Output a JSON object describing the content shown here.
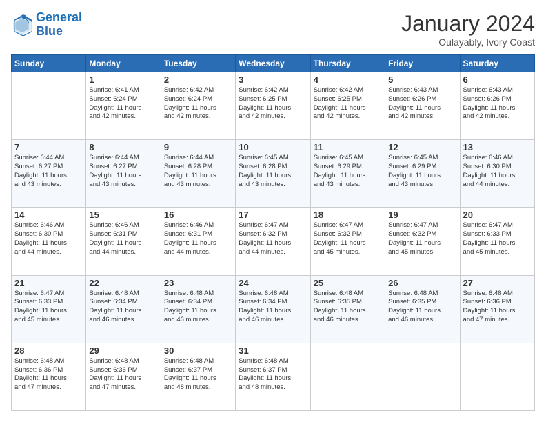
{
  "header": {
    "logo_text_general": "General",
    "logo_text_blue": "Blue",
    "month_title": "January 2024",
    "subtitle": "Oulayably, Ivory Coast"
  },
  "days_of_week": [
    "Sunday",
    "Monday",
    "Tuesday",
    "Wednesday",
    "Thursday",
    "Friday",
    "Saturday"
  ],
  "weeks": [
    [
      {
        "day": "",
        "info": ""
      },
      {
        "day": "1",
        "info": "Sunrise: 6:41 AM\nSunset: 6:24 PM\nDaylight: 11 hours\nand 42 minutes."
      },
      {
        "day": "2",
        "info": "Sunrise: 6:42 AM\nSunset: 6:24 PM\nDaylight: 11 hours\nand 42 minutes."
      },
      {
        "day": "3",
        "info": "Sunrise: 6:42 AM\nSunset: 6:25 PM\nDaylight: 11 hours\nand 42 minutes."
      },
      {
        "day": "4",
        "info": "Sunrise: 6:42 AM\nSunset: 6:25 PM\nDaylight: 11 hours\nand 42 minutes."
      },
      {
        "day": "5",
        "info": "Sunrise: 6:43 AM\nSunset: 6:26 PM\nDaylight: 11 hours\nand 42 minutes."
      },
      {
        "day": "6",
        "info": "Sunrise: 6:43 AM\nSunset: 6:26 PM\nDaylight: 11 hours\nand 42 minutes."
      }
    ],
    [
      {
        "day": "7",
        "info": "Sunrise: 6:44 AM\nSunset: 6:27 PM\nDaylight: 11 hours\nand 43 minutes."
      },
      {
        "day": "8",
        "info": "Sunrise: 6:44 AM\nSunset: 6:27 PM\nDaylight: 11 hours\nand 43 minutes."
      },
      {
        "day": "9",
        "info": "Sunrise: 6:44 AM\nSunset: 6:28 PM\nDaylight: 11 hours\nand 43 minutes."
      },
      {
        "day": "10",
        "info": "Sunrise: 6:45 AM\nSunset: 6:28 PM\nDaylight: 11 hours\nand 43 minutes."
      },
      {
        "day": "11",
        "info": "Sunrise: 6:45 AM\nSunset: 6:29 PM\nDaylight: 11 hours\nand 43 minutes."
      },
      {
        "day": "12",
        "info": "Sunrise: 6:45 AM\nSunset: 6:29 PM\nDaylight: 11 hours\nand 43 minutes."
      },
      {
        "day": "13",
        "info": "Sunrise: 6:46 AM\nSunset: 6:30 PM\nDaylight: 11 hours\nand 44 minutes."
      }
    ],
    [
      {
        "day": "14",
        "info": "Sunrise: 6:46 AM\nSunset: 6:30 PM\nDaylight: 11 hours\nand 44 minutes."
      },
      {
        "day": "15",
        "info": "Sunrise: 6:46 AM\nSunset: 6:31 PM\nDaylight: 11 hours\nand 44 minutes."
      },
      {
        "day": "16",
        "info": "Sunrise: 6:46 AM\nSunset: 6:31 PM\nDaylight: 11 hours\nand 44 minutes."
      },
      {
        "day": "17",
        "info": "Sunrise: 6:47 AM\nSunset: 6:32 PM\nDaylight: 11 hours\nand 44 minutes."
      },
      {
        "day": "18",
        "info": "Sunrise: 6:47 AM\nSunset: 6:32 PM\nDaylight: 11 hours\nand 45 minutes."
      },
      {
        "day": "19",
        "info": "Sunrise: 6:47 AM\nSunset: 6:32 PM\nDaylight: 11 hours\nand 45 minutes."
      },
      {
        "day": "20",
        "info": "Sunrise: 6:47 AM\nSunset: 6:33 PM\nDaylight: 11 hours\nand 45 minutes."
      }
    ],
    [
      {
        "day": "21",
        "info": "Sunrise: 6:47 AM\nSunset: 6:33 PM\nDaylight: 11 hours\nand 45 minutes."
      },
      {
        "day": "22",
        "info": "Sunrise: 6:48 AM\nSunset: 6:34 PM\nDaylight: 11 hours\nand 46 minutes."
      },
      {
        "day": "23",
        "info": "Sunrise: 6:48 AM\nSunset: 6:34 PM\nDaylight: 11 hours\nand 46 minutes."
      },
      {
        "day": "24",
        "info": "Sunrise: 6:48 AM\nSunset: 6:34 PM\nDaylight: 11 hours\nand 46 minutes."
      },
      {
        "day": "25",
        "info": "Sunrise: 6:48 AM\nSunset: 6:35 PM\nDaylight: 11 hours\nand 46 minutes."
      },
      {
        "day": "26",
        "info": "Sunrise: 6:48 AM\nSunset: 6:35 PM\nDaylight: 11 hours\nand 46 minutes."
      },
      {
        "day": "27",
        "info": "Sunrise: 6:48 AM\nSunset: 6:36 PM\nDaylight: 11 hours\nand 47 minutes."
      }
    ],
    [
      {
        "day": "28",
        "info": "Sunrise: 6:48 AM\nSunset: 6:36 PM\nDaylight: 11 hours\nand 47 minutes."
      },
      {
        "day": "29",
        "info": "Sunrise: 6:48 AM\nSunset: 6:36 PM\nDaylight: 11 hours\nand 47 minutes."
      },
      {
        "day": "30",
        "info": "Sunrise: 6:48 AM\nSunset: 6:37 PM\nDaylight: 11 hours\nand 48 minutes."
      },
      {
        "day": "31",
        "info": "Sunrise: 6:48 AM\nSunset: 6:37 PM\nDaylight: 11 hours\nand 48 minutes."
      },
      {
        "day": "",
        "info": ""
      },
      {
        "day": "",
        "info": ""
      },
      {
        "day": "",
        "info": ""
      }
    ]
  ]
}
